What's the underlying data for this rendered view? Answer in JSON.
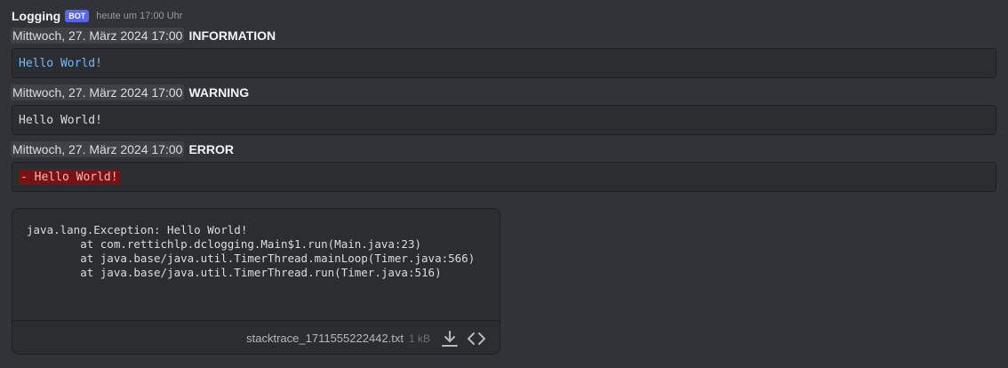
{
  "message": {
    "username": "Logging",
    "bot_tag": "BOT",
    "timestamp": "heute um 17:00 Uhr"
  },
  "logs": [
    {
      "time": "Mittwoch, 27. März 2024 17:00",
      "level": "INFORMATION",
      "text": "Hello World!"
    },
    {
      "time": "Mittwoch, 27. März 2024 17:00",
      "level": "WARNING",
      "text": "Hello World!"
    },
    {
      "time": "Mittwoch, 27. März 2024 17:00",
      "level": "ERROR",
      "text": "- Hello World!"
    }
  ],
  "attachment": {
    "content": "java.lang.Exception: Hello World!\n        at com.rettichlp.dclogging.Main$1.run(Main.java:23)\n        at java.base/java.util.TimerThread.mainLoop(Timer.java:566)\n        at java.base/java.util.TimerThread.run(Timer.java:516)",
    "filename": "stacktrace_1711555222442.txt",
    "size": "1 kB",
    "download_icon": "download-icon",
    "code_icon": "code-icon"
  },
  "colors": {
    "background": "#313338",
    "codeblock": "#2b2d31",
    "bot_tag": "#5865f2",
    "info_text": "#74b9f5",
    "error_bg": "#7a1112"
  }
}
